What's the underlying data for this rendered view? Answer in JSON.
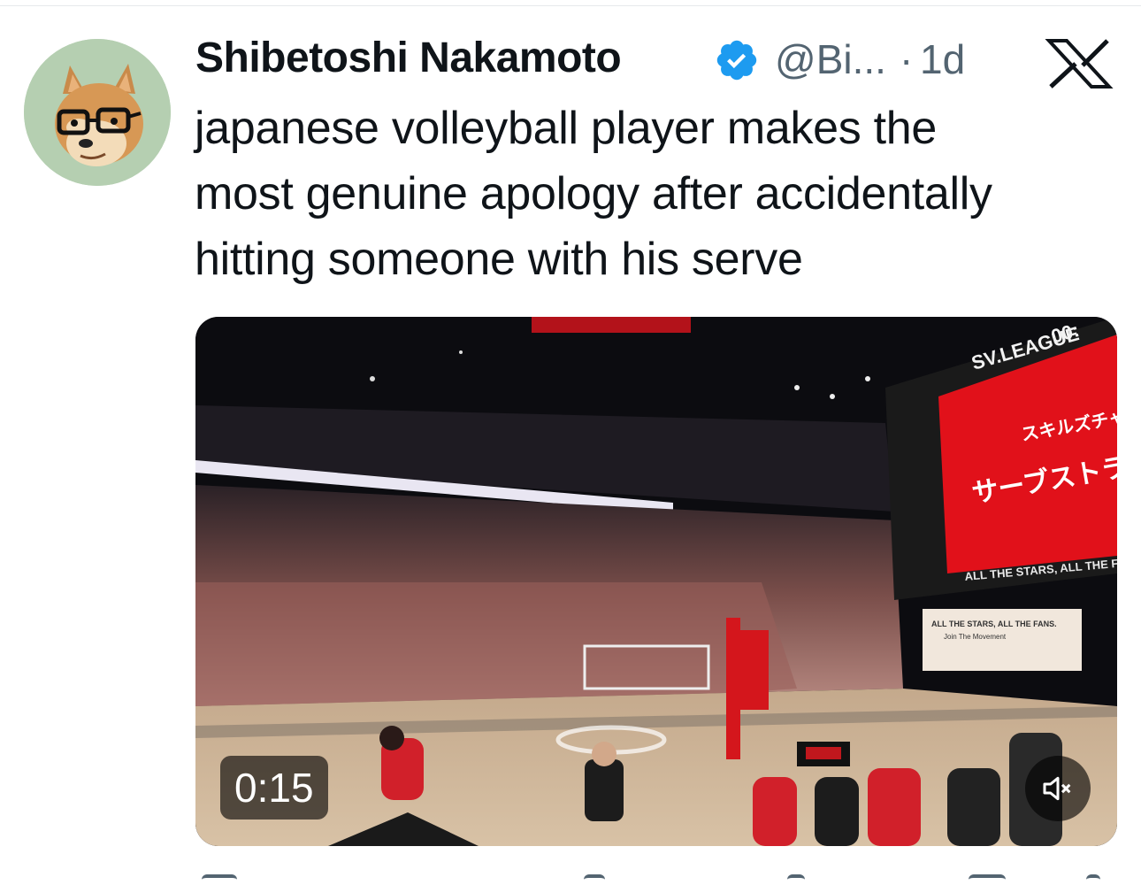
{
  "author": {
    "name": "Shibetoshi Nakamoto",
    "handle": "@Bi...",
    "separator": "·",
    "time": "1d",
    "verified": true
  },
  "tweet": {
    "lines": [
      "japanese volleyball player makes the",
      "most genuine apology after accidentally",
      "hitting someone with his serve"
    ]
  },
  "video": {
    "duration": "0:15",
    "muted": true,
    "scene_text": {
      "league": "SV.LEAGUE",
      "clock": "00:",
      "screen_sub": "スキルズチャ",
      "screen_main": "サーブストラ",
      "banner": "ALL THE STARS, ALL THE FANS",
      "board_line1": "ALL THE STARS, ALL THE FANS.",
      "board_line2": "Join The Movement"
    }
  },
  "icons": {
    "verified": "verified-badge-icon",
    "logo": "x-logo-icon",
    "mute": "speaker-muted-icon"
  },
  "colors": {
    "verified": "#1d9bf0",
    "secondary_text": "#536471",
    "screen_red": "#e1111a"
  }
}
